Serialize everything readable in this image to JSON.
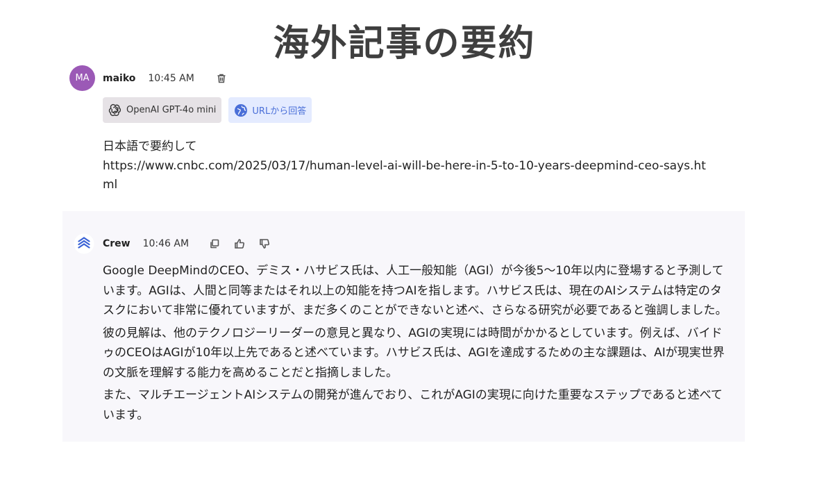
{
  "page": {
    "title": "海外記事の要約"
  },
  "user_message": {
    "avatar_initials": "MA",
    "avatar_color": "#9b59b6",
    "username": "maiko",
    "time": "10:45 AM",
    "chips": {
      "model": "OpenAI GPT-4o mini",
      "mode": "URLから回答"
    },
    "text_line1": "日本語で要約して",
    "text_line2": "https://www.cnbc.com/2025/03/17/human-level-ai-will-be-here-in-5-to-10-years-deepmind-ceo-says.html"
  },
  "bot_message": {
    "name": "Crew",
    "time": "10:46 AM",
    "paragraphs": [
      "Google DeepMindのCEO、デミス・ハサビス氏は、人工一般知能（AGI）が今後5〜10年以内に登場すると予測しています。AGIは、人間と同等またはそれ以上の知能を持つAIを指します。ハサビス氏は、現在のAIシステムは特定のタスクにおいて非常に優れていますが、まだ多くのことができないと述べ、さらなる研究が必要であると強調しました。",
      "彼の見解は、他のテクノロジーリーダーの意見と異なり、AGIの実現には時間がかかるとしています。例えば、バイドゥのCEOはAGIが10年以上先であると述べています。ハサビス氏は、AGIを達成するための主な課題は、AIが現実世界の文脈を理解する能力を高めることだと指摘しました。",
      "また、マルチエージェントAIシステムの開発が進んでおり、これがAGIの実現に向けた重要なステップであると述べています。"
    ]
  },
  "colors": {
    "accent_blue": "#4a6fd8",
    "bot_bg": "#f8f7fb"
  }
}
